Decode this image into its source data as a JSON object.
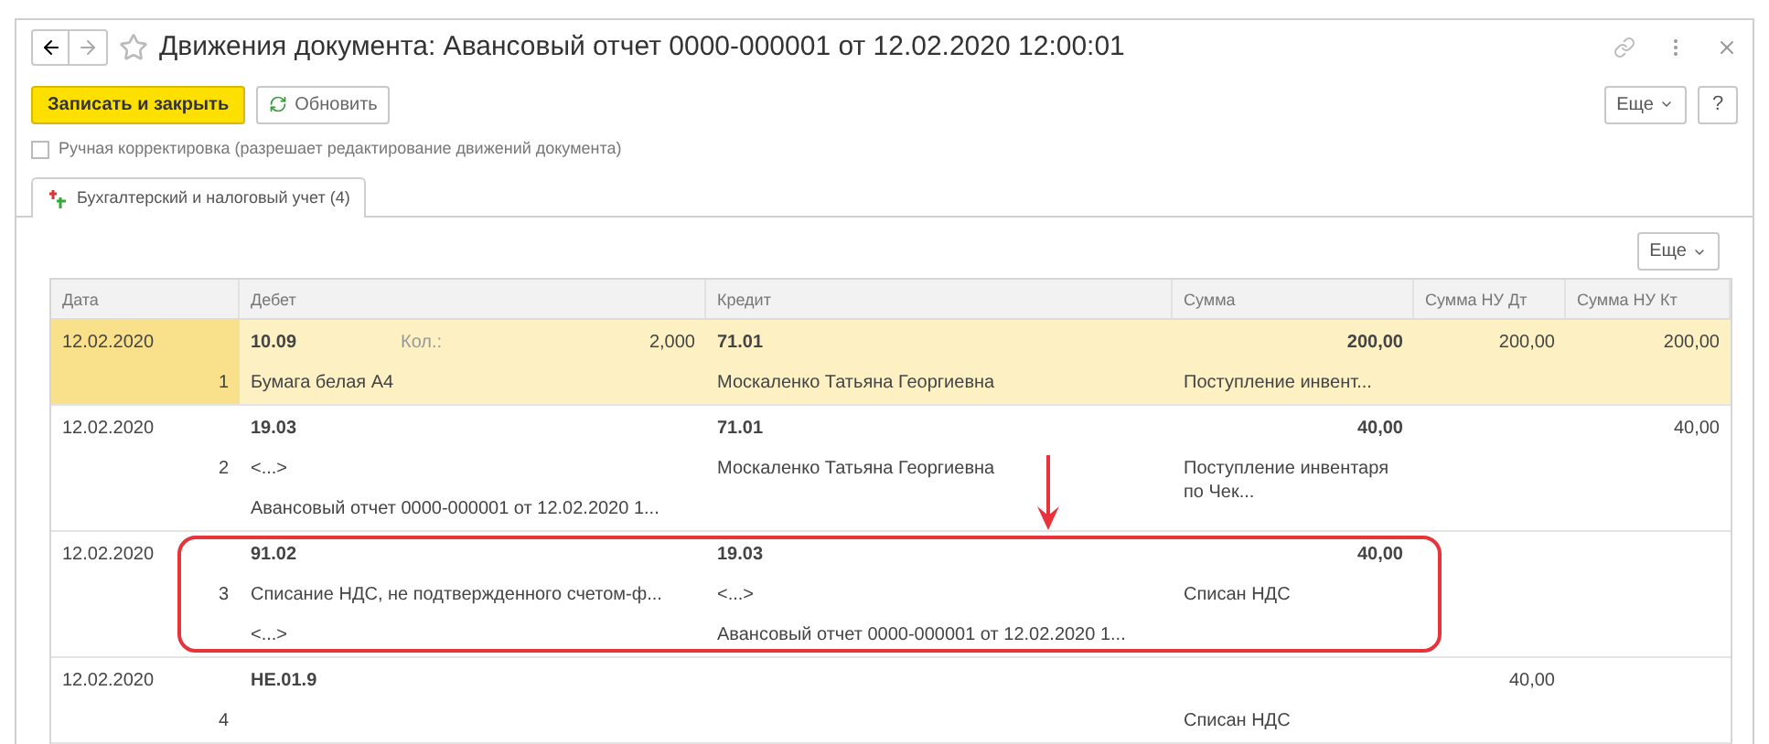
{
  "window": {
    "title": "Движения документа: Авансовый отчет 0000-000001 от 12.02.2020 12:00:01"
  },
  "toolbar": {
    "buttons": [
      {
        "label": "Записать и закрыть",
        "kind": "primary"
      },
      {
        "label": "Обновить",
        "kind": "refresh"
      }
    ],
    "more": "Еще",
    "help": "?"
  },
  "manual_edit": {
    "label": "Ручная корректировка (разрешает редактирование движений документа)",
    "checked": false
  },
  "tabs": [
    {
      "label": "Бухгалтерский и налоговый учет (4)",
      "selected": true
    }
  ],
  "table": {
    "more": "Еще",
    "columns": [
      "Дата",
      "Дебет",
      "Кредит",
      "Сумма",
      "Сумма НУ Дт",
      "Сумма НУ Кт"
    ],
    "rows": [
      {
        "date": "12.02.2020",
        "number": "1",
        "selected": true,
        "highlighted": false,
        "debit": {
          "account": "10.09",
          "qty_label": "Кол.:",
          "qty": "2,000",
          "lines": [
            "Бумага белая А4"
          ]
        },
        "credit": {
          "account": "71.01",
          "lines": [
            "Москаленко Татьяна Георгиевна"
          ]
        },
        "amount": "200,00",
        "amount_note": "Поступление инвент...",
        "nu_dt": "200,00",
        "nu_kt": "200,00"
      },
      {
        "date": "12.02.2020",
        "number": "2",
        "selected": false,
        "highlighted": false,
        "debit": {
          "account": "19.03",
          "lines": [
            "<...>",
            "Авансовый отчет 0000-000001 от 12.02.2020 1..."
          ]
        },
        "credit": {
          "account": "71.01",
          "lines": [
            "Москаленко Татьяна Георгиевна"
          ]
        },
        "amount": "40,00",
        "amount_note": "Поступление инвентаря по Чек...",
        "nu_kt": "40,00"
      },
      {
        "date": "12.02.2020",
        "number": "3",
        "selected": false,
        "highlighted": true,
        "debit": {
          "account": "91.02",
          "lines": [
            "Списание НДС, не подтвержденного счетом-ф...",
            "<...>"
          ]
        },
        "credit": {
          "account": "19.03",
          "lines": [
            "<...>",
            "Авансовый отчет 0000-000001 от 12.02.2020 1..."
          ]
        },
        "amount": "40,00",
        "amount_note": "Списан НДС"
      },
      {
        "date": "12.02.2020",
        "number": "4",
        "selected": false,
        "highlighted": false,
        "debit": {
          "account": "НЕ.01.9"
        },
        "credit": {},
        "amount_note": "Списан НДС",
        "nu_dt": "40,00"
      }
    ]
  }
}
